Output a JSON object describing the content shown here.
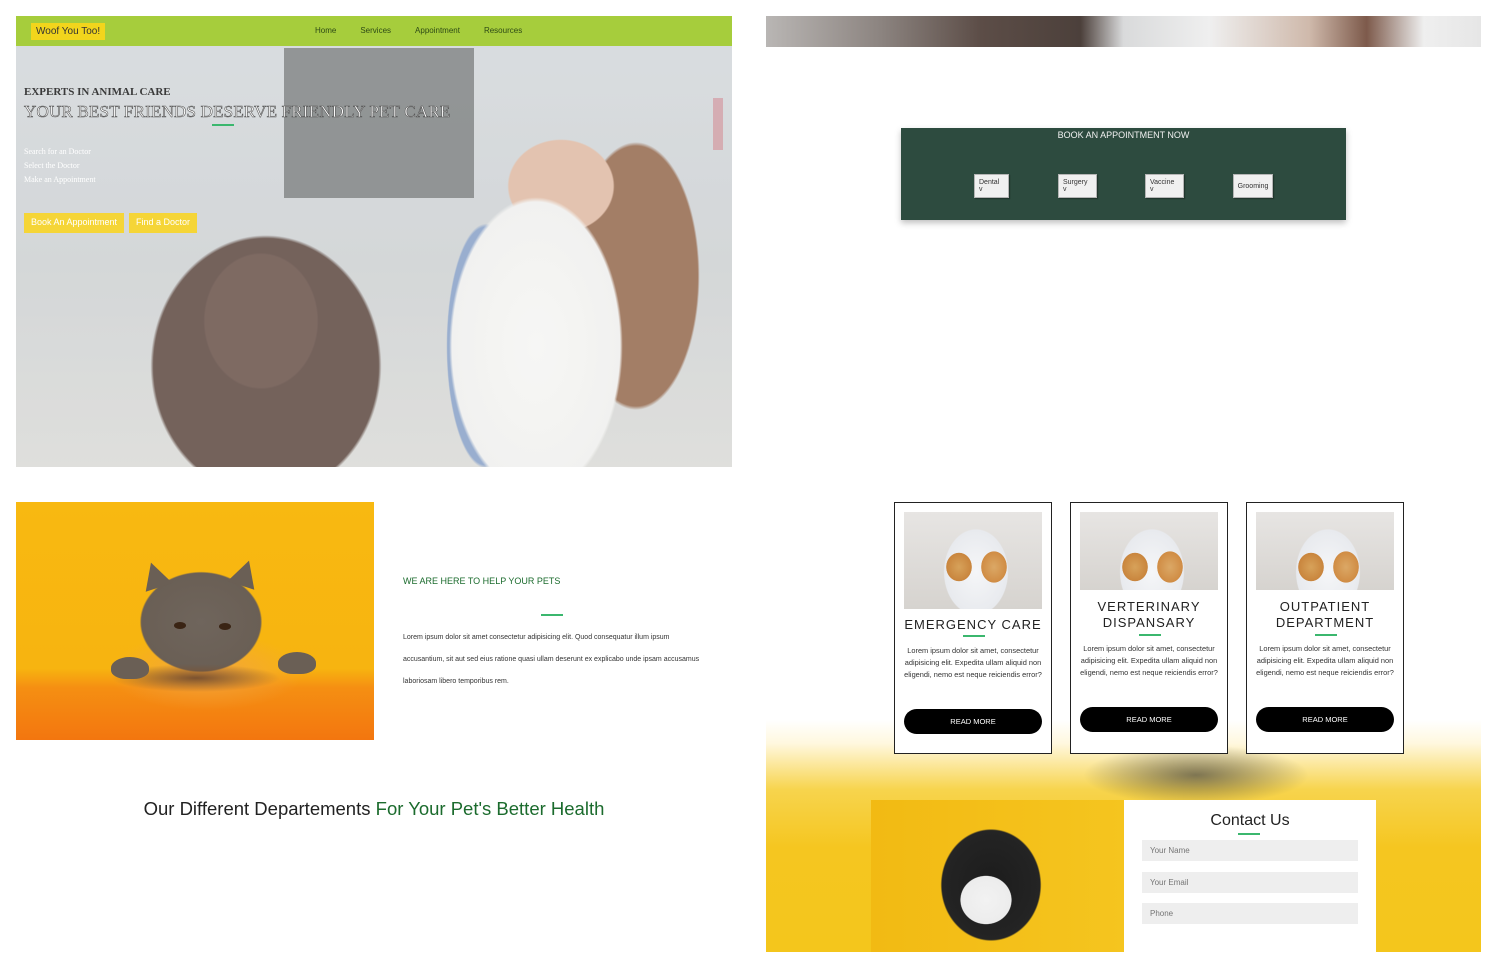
{
  "nav": {
    "logo": "Woof You Too!",
    "links": [
      "Home",
      "Services",
      "Appointment",
      "Resources"
    ]
  },
  "hero": {
    "eyebrow": "EXPERTS IN ANIMAL CARE",
    "headline": "YOUR BEST FRIENDS DESERVE FRIENDLY PET CARE",
    "steps": [
      "Search for an Doctor",
      "Select the Doctor",
      "Make an Appointment"
    ],
    "buttons": [
      "Book An Appointment",
      "Find a Doctor"
    ]
  },
  "booking": {
    "title": "BOOK AN APPOINTMENT NOW",
    "dropdowns": [
      "Dental v",
      "Surgery v",
      "Vaccine v",
      "Grooming"
    ]
  },
  "about": {
    "heading": "WE ARE HERE TO HELP YOUR PETS",
    "body": "Lorem ipsum dolor sit amet consectetur adipisicing elit. Quod consequatur illum ipsum accusantium, sit aut sed eius ratione quasi ullam deserunt ex explicabo unde ipsam accusamus laboriosam libero temporibus rem."
  },
  "departments": {
    "heading_plain": "Our Different Departements ",
    "heading_highlight": "For Your Pet's Better Health",
    "cards": [
      {
        "title": "EMERGENCY CARE",
        "text": "Lorem ipsum dolor sit amet, consectetur adipisicing elit. Expedita ullam aliquid non eligendi, nemo est neque reiciendis error?",
        "button": "READ MORE"
      },
      {
        "title": "VERTERINARY DISPANSARY",
        "text": "Lorem ipsum dolor sit amet, consectetur adipisicing elit. Expedita ullam aliquid non eligendi, nemo est neque reiciendis error?",
        "button": "READ MORE"
      },
      {
        "title": "OUTPATIENT DEPARTMENT",
        "text": "Lorem ipsum dolor sit amet, consectetur adipisicing elit. Expedita ullam aliquid non eligendi, nemo est neque reiciendis error?",
        "button": "READ MORE"
      }
    ]
  },
  "contact": {
    "title": "Contact Us",
    "placeholders": {
      "name": "Your Name",
      "email": "Your Email",
      "phone": "Phone"
    }
  },
  "colors": {
    "nav_green": "#a6cd3c",
    "accent_yellow": "#f5d537",
    "booking_green": "#2d4b3f",
    "rule_green": "#3bb76e",
    "text_green": "#1b6b2d"
  },
  "icons": [
    "hero-photo-vet-dog",
    "cat-photo",
    "vet-puppy-kitten-photo",
    "dog-stethoscope-photo"
  ]
}
